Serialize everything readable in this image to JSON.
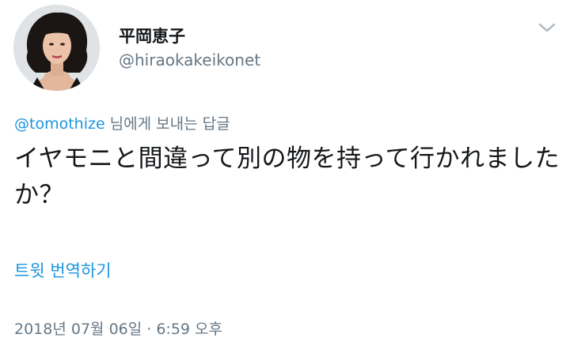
{
  "author": {
    "display_name": "平岡恵子",
    "handle": "@hiraokakeikonet"
  },
  "reply": {
    "mention": "@tomothize",
    "suffix": " 님에게 보내는 답글"
  },
  "tweet": {
    "text": "イヤモニと間違って別の物を持って行かれましたか？"
  },
  "translate_label": "트윗 번역하기",
  "timestamp": "2018년 07월 06일 · 6:59 오후",
  "icons": {
    "menu": "chevron-down-icon",
    "avatar": "profile-photo"
  },
  "colors": {
    "link": "#1b95e0",
    "secondary_text": "#657786",
    "primary_text": "#14171a"
  }
}
